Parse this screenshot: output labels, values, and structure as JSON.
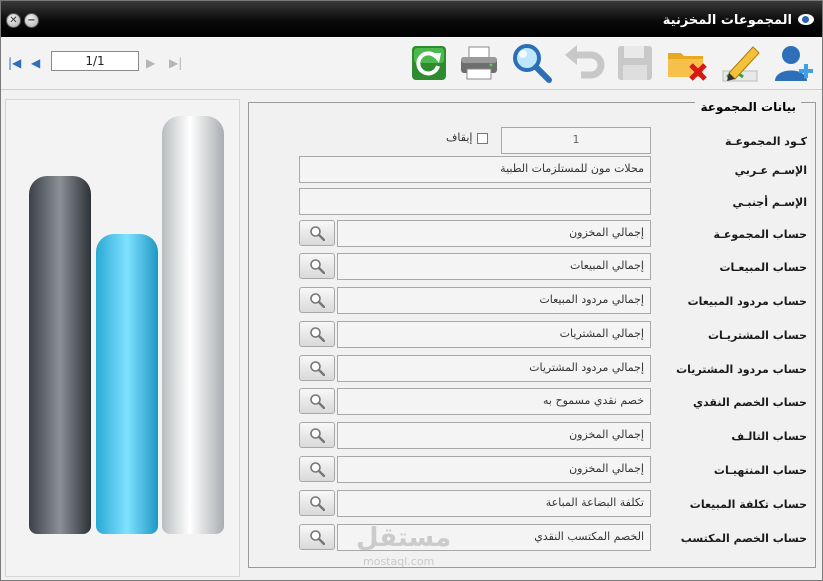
{
  "window": {
    "title": "المجموعات المخزنية"
  },
  "pager": {
    "value": "1/1"
  },
  "toolbar": {
    "icons": [
      "refresh-icon",
      "print-icon",
      "search-icon",
      "undo-icon",
      "save-icon",
      "delete-icon",
      "edit-icon",
      "add-user-icon"
    ]
  },
  "group": {
    "legend": "بيانات المجموعة",
    "code_label": "كـود المجموعـة",
    "code_value": "1",
    "stop_label": "إيقاف",
    "name_ar_label": "الإسـم عـربي",
    "name_ar_value": "محلات مون للمستلزمات الطبية",
    "name_en_label": "الإسـم أجنبـي",
    "name_en_value": "",
    "accounts": [
      {
        "label": "حساب المجموعـة",
        "value": "إجمالي المخزون"
      },
      {
        "label": "حساب المبيعـات",
        "value": "إجمالي المبيعات"
      },
      {
        "label": "حساب مردود المبيعات",
        "value": "إجمالي مردود المبيعات"
      },
      {
        "label": "حساب المشتريـات",
        "value": "إجمالي المشتريات"
      },
      {
        "label": "حساب مردود المشتريات",
        "value": "إجمالي مردود المشتريات"
      },
      {
        "label": "حساب الخصم النقدي",
        "value": "خصم نقدي مسموح به"
      },
      {
        "label": "حساب التالـف",
        "value": "إجمالي المخزون"
      },
      {
        "label": "حساب المنتهيـات",
        "value": "إجمالي المخزون"
      },
      {
        "label": "حساب تكلفة المبيعات",
        "value": "تكلفة البضاعة المباعة"
      },
      {
        "label": "حساب الخصم المكتسب",
        "value": "الخصم المكتسب النقدي"
      }
    ]
  },
  "watermark": {
    "ar": "مستقل",
    "en": "mostaql.com"
  },
  "colors": {
    "titlebar": "#000000",
    "nav_blue": "#2f6fb8",
    "bar_cyan": "#39c3e8"
  }
}
